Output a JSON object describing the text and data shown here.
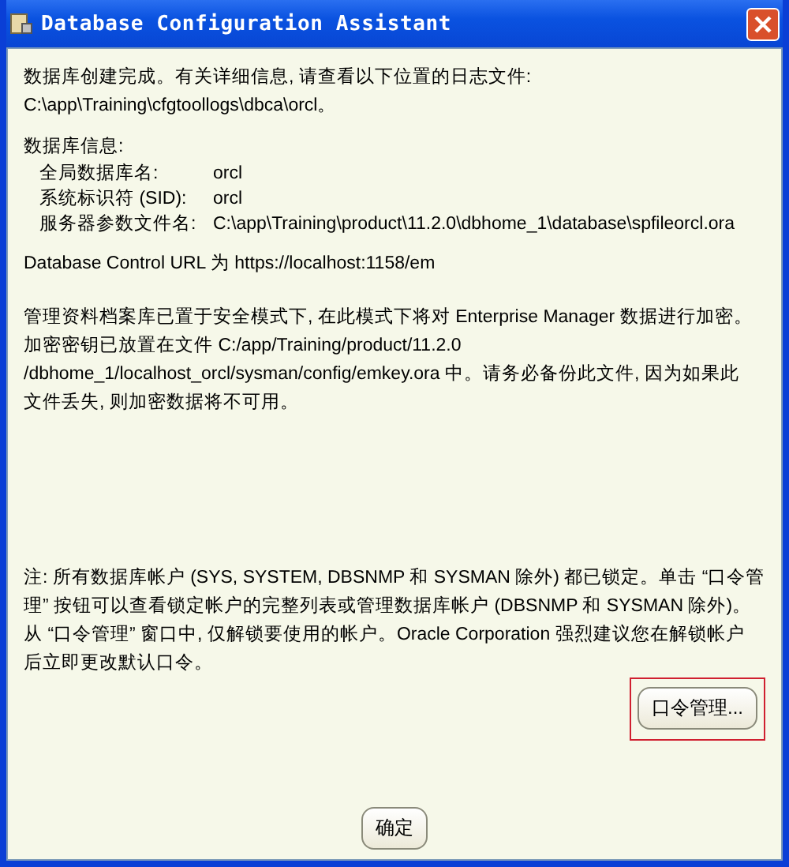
{
  "window": {
    "title": "Database Configuration Assistant"
  },
  "log_message": [
    "数据库创建完成。有关详细信息, 请查看以下位置的日志文件:",
    " C:\\app\\Training\\cfgtoollogs\\dbca\\orcl。"
  ],
  "database_info": {
    "heading": "数据库信息:",
    "rows": [
      {
        "label": "全局数据库名:",
        "value": "orcl"
      },
      {
        "label": "系统标识符 (SID):",
        "value": "orcl"
      },
      {
        "label": "服务器参数文件名:",
        "value": "C:\\app\\Training\\product\\11.2.0\\dbhome_1\\database\\spfileorcl.ora"
      }
    ]
  },
  "control_url": "Database Control URL 为 https://localhost:1158/em",
  "encryption_note": [
    "管理资料档案库已置于安全模式下, 在此模式下将对 Enterprise Manager 数据进行加密。",
    "加密密钥已放置在文件 C:/app/Training/product/11.2.0",
    "/dbhome_1/localhost_orcl/sysman/config/emkey.ora 中。请务必备份此文件, 因为如果此",
    "文件丢失, 则加密数据将不可用。"
  ],
  "account_note": [
    "注: 所有数据库帐户 (SYS, SYSTEM, DBSNMP 和 SYSMAN 除外) 都已锁定。单击 “口令管",
    "理” 按钮可以查看锁定帐户的完整列表或管理数据库帐户 (DBSNMP 和 SYSMAN 除外)。",
    "从 “口令管理” 窗口中, 仅解锁要使用的帐户。Oracle Corporation 强烈建议您在解锁帐户",
    "后立即更改默认口令。"
  ],
  "password_button": {
    "label": "口令管理...",
    "highlighted": true
  },
  "ok_button": {
    "label": "确定"
  }
}
